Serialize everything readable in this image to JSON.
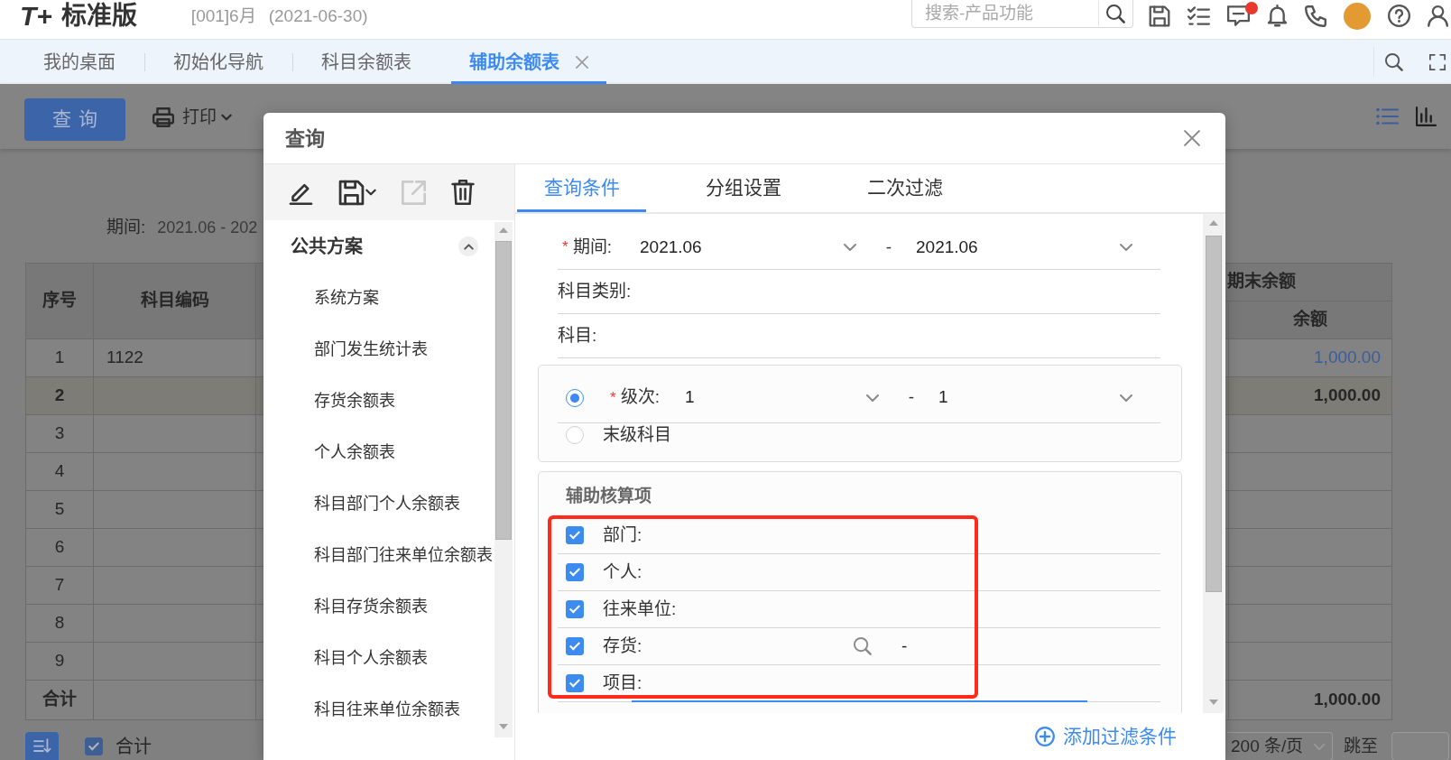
{
  "header": {
    "logo_mark": "T+",
    "logo_text": "标准版",
    "account": "[001]6月",
    "date": "(2021-06-30)",
    "search": {
      "placeholder": "搜索-产品功能"
    },
    "message_badge": true
  },
  "tabs": [
    {
      "label": "我的桌面",
      "selected": false,
      "closable": false
    },
    {
      "label": "初始化导航",
      "selected": false,
      "closable": false
    },
    {
      "label": "科目余额表",
      "selected": false,
      "closable": false
    },
    {
      "label": "辅助余额表",
      "selected": true,
      "closable": true
    }
  ],
  "page": {
    "toolbar": {
      "query_button": "查询",
      "print_button": "打印",
      "views": [
        {
          "kind": "list",
          "selected": true
        },
        {
          "kind": "chart",
          "selected": false
        }
      ]
    },
    "period": {
      "label": "期间:",
      "value": "2021.06 - 202"
    },
    "table": {
      "columns": [
        "序号",
        "科目编码"
      ],
      "group_header": "期末余额",
      "balance_column": "余额",
      "rows": [
        {
          "no": "1",
          "code": "1122",
          "balance": "1,000.00",
          "kind": "detail"
        },
        {
          "no": "2",
          "balance": "1,000.00",
          "kind": "subtotal"
        },
        {
          "no": "3",
          "kind": "detail"
        },
        {
          "no": "4",
          "kind": "detail"
        },
        {
          "no": "5",
          "kind": "detail"
        },
        {
          "no": "6",
          "kind": "detail"
        },
        {
          "no": "7",
          "kind": "detail"
        },
        {
          "no": "8",
          "kind": "detail"
        },
        {
          "no": "9",
          "kind": "detail"
        }
      ],
      "total": {
        "label": "合计",
        "balance": "1,000.00"
      }
    },
    "footer": {
      "show_total": {
        "label": "合计",
        "checked": true
      },
      "page_size": "200 条/页",
      "jump_label": "跳至"
    }
  },
  "dialog": {
    "title": "查询",
    "toolbar": [
      {
        "kind": "edit",
        "disabled": false
      },
      {
        "kind": "save",
        "disabled": false,
        "dropdown": true
      },
      {
        "kind": "export",
        "disabled": true
      },
      {
        "kind": "delete",
        "disabled": false
      }
    ],
    "schemes": {
      "title": "公共方案",
      "expanded": true,
      "items": [
        "系统方案",
        "部门发生统计表",
        "存货余额表",
        "个人余额表",
        "科目部门个人余额表",
        "科目部门往来单位余额表",
        "科目存货余额表",
        "科目个人余额表",
        "科目往来单位余额表"
      ]
    },
    "tabs": [
      {
        "label": "查询条件",
        "selected": true
      },
      {
        "label": "分组设置",
        "selected": false
      },
      {
        "label": "二次过滤",
        "selected": false
      }
    ],
    "fields": [
      {
        "kind": "range",
        "required_mark": "*",
        "label": "期间:",
        "from": "2021.06",
        "separator": "-",
        "to": "2021.06"
      },
      {
        "kind": "text",
        "label": "科目类别:"
      },
      {
        "kind": "text",
        "label": "科目:"
      }
    ],
    "level_options": [
      {
        "kind": "range",
        "selected": true,
        "required_mark": "*",
        "label": "级次:",
        "from": "1",
        "separator": "-",
        "to": "1"
      },
      {
        "kind": "plain",
        "selected": false,
        "label": "末级科目"
      }
    ],
    "auxiliary": {
      "title": "辅助核算项",
      "highlighted": true,
      "items": [
        {
          "kind": "text",
          "checked": true,
          "focused": false,
          "label": "部门:"
        },
        {
          "kind": "text",
          "checked": true,
          "focused": false,
          "label": "个人:"
        },
        {
          "kind": "text",
          "checked": true,
          "focused": false,
          "label": "往来单位:"
        },
        {
          "kind": "lookup",
          "checked": true,
          "focused": false,
          "label": "存货:",
          "separator": "-"
        },
        {
          "kind": "text",
          "checked": true,
          "focused": true,
          "label": "项目:"
        }
      ]
    },
    "add_filter": "添加过滤条件"
  }
}
